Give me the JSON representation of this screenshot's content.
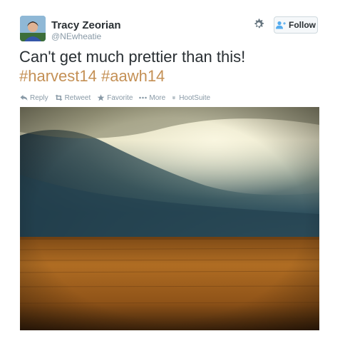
{
  "user": {
    "name": "Tracy Zeorian",
    "handle": "@NEwheatie"
  },
  "follow_button": {
    "label": "Follow"
  },
  "tweet": {
    "text_line1": "Can't get much prettier than this!",
    "hashtags": [
      "#harvest14",
      "#aawh14"
    ]
  },
  "actions": {
    "reply": "Reply",
    "retweet": "Retweet",
    "favorite": "Favorite",
    "more": "More",
    "hootsuite": "HootSuite"
  },
  "colors": {
    "hashtag": "#c49055",
    "muted": "#8899a6",
    "follow_icon": "#55acee"
  },
  "icons": {
    "settings": "gear-icon",
    "follow": "add-user-icon",
    "reply": "reply-icon",
    "retweet": "retweet-icon",
    "favorite": "star-icon",
    "more": "ellipsis-icon",
    "hootsuite": "owl-icon"
  }
}
